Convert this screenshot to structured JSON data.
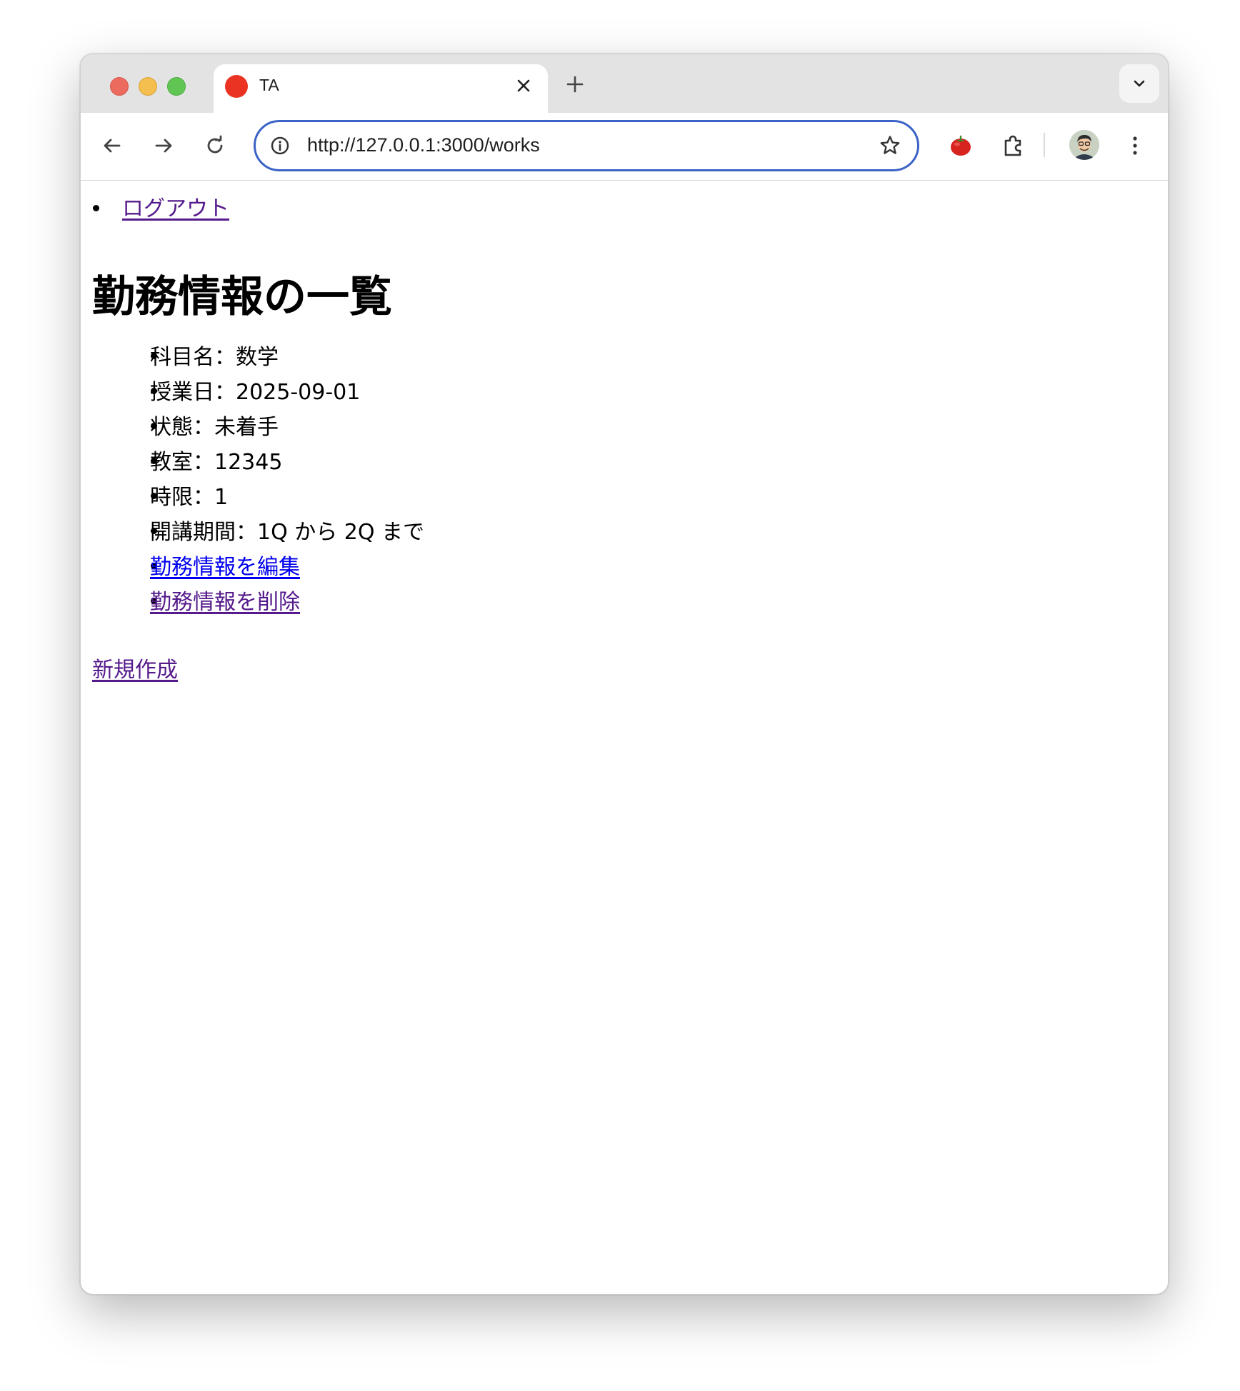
{
  "browser": {
    "tab": {
      "title": "TA",
      "favicon_color": "#ea3323"
    },
    "address_bar": {
      "url": "http://127.0.0.1:3000/works"
    },
    "icons": {
      "back": "arrow-left-icon",
      "forward": "arrow-right-icon",
      "reload": "reload-icon",
      "info": "info-icon",
      "bookmark": "star-icon",
      "extension_tomato": "tomato-icon",
      "extensions": "puzzle-icon",
      "menu": "kebab-menu-icon",
      "tab_list": "chevron-down-icon"
    },
    "accent_color": "#3b62c6"
  },
  "page": {
    "nav": {
      "logout_label": "ログアウト"
    },
    "title": "勤務情報の一覧",
    "work": {
      "subject": "科目名：数学",
      "date": "授業日：2025-09-01",
      "status": "状態：未着手",
      "classroom": "教室：12345",
      "period": "時限：1",
      "term": "開講期間：1Q から 2Q まで",
      "edit_label": "勤務情報を編集",
      "delete_label": "勤務情報を削除"
    },
    "new_label": "新規作成",
    "link_color": "#0000ee",
    "visited_link_color": "#551a8b"
  }
}
